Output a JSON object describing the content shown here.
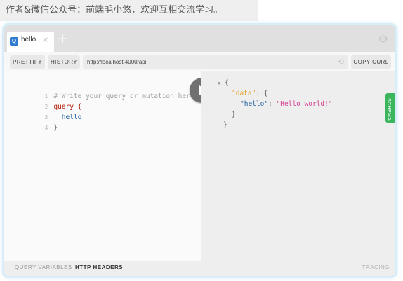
{
  "caption": "作者&微信公众号：前端毛小悠，欢迎互相交流学习。",
  "tabs": [
    {
      "badge": "Q",
      "label": "hello",
      "close": "×"
    }
  ],
  "tab_add": "+",
  "settings_icon": "gear-icon",
  "toolbar": {
    "prettify": "PRETTIFY",
    "history": "HISTORY",
    "url": "http://localhost:4000/api",
    "copy_curl": "COPY CURL"
  },
  "editor": {
    "lines": [
      {
        "num": "1",
        "text": "# Write your query or mutation here"
      },
      {
        "num": "2",
        "text": "query {"
      },
      {
        "num": "3",
        "text": "hello"
      },
      {
        "num": "4",
        "text": "}"
      }
    ]
  },
  "result": {
    "data_key": "\"data\"",
    "hello_key": "\"hello\"",
    "hello_value": "\"Hello world!\""
  },
  "schema_tab": "SCHEMA",
  "footer": {
    "query_variables": "QUERY VARIABLES",
    "http_headers": "HTTP HEADERS",
    "tracing": "TRACING"
  },
  "colors": {
    "accent_blue": "#2e7bcf",
    "schema_green": "#3cb65c",
    "string_pink": "#d64292",
    "key_orange": "#e8a12a"
  }
}
